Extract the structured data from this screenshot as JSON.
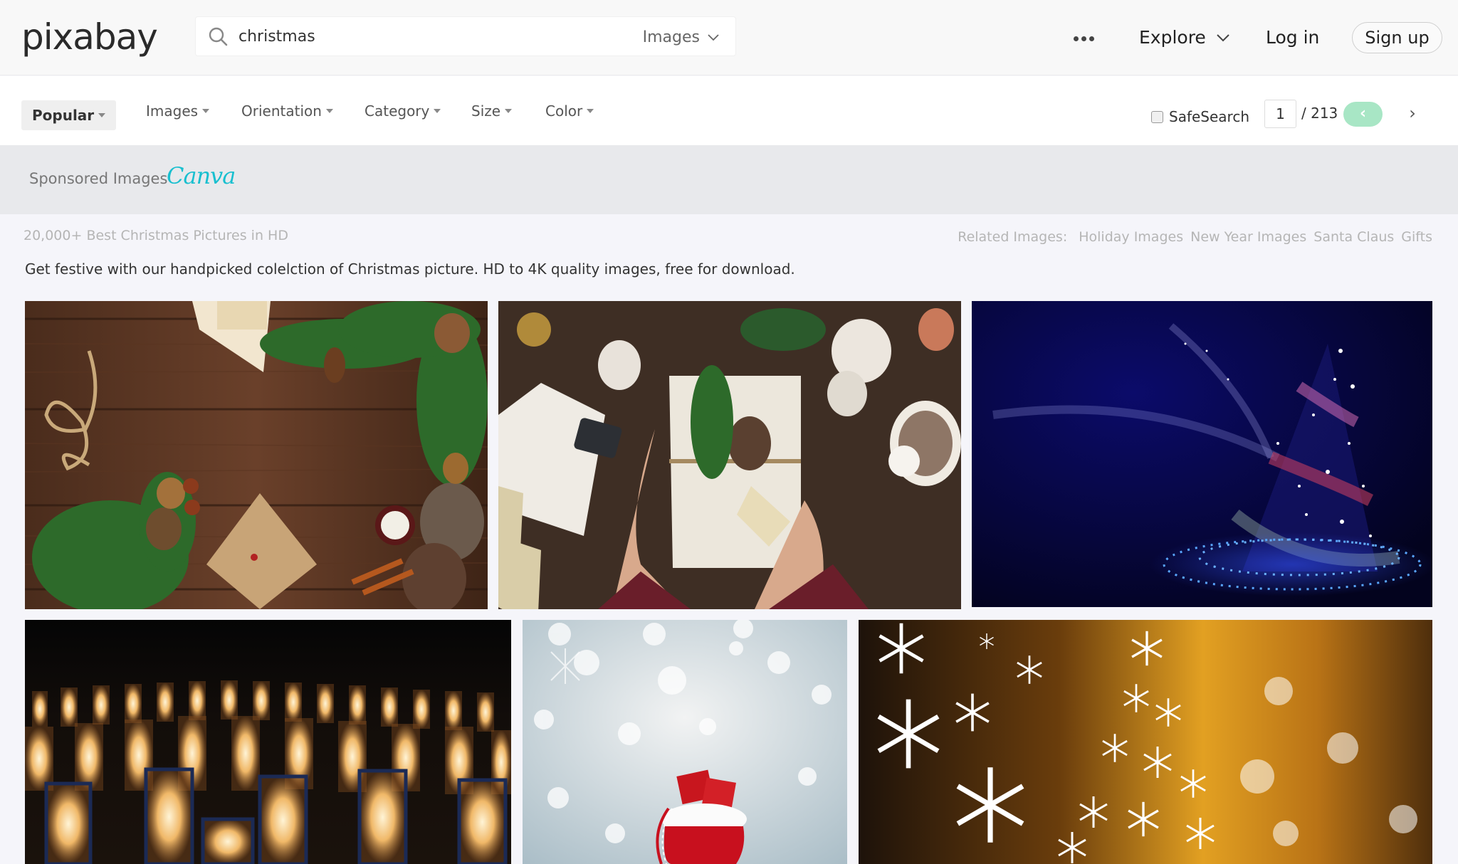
{
  "header": {
    "logo": "pixabay",
    "search": {
      "query": "christmas",
      "type_selector": "Images"
    },
    "nav": {
      "more_icon": "ellipsis-icon",
      "explore": "Explore",
      "login": "Log in",
      "signup": "Sign up"
    }
  },
  "filters": {
    "items": [
      {
        "label": "Popular",
        "active": true
      },
      {
        "label": "Images",
        "active": false
      },
      {
        "label": "Orientation",
        "active": false
      },
      {
        "label": "Category",
        "active": false
      },
      {
        "label": "Size",
        "active": false
      },
      {
        "label": "Color",
        "active": false
      }
    ],
    "safesearch": {
      "label": "SafeSearch",
      "checked": false
    },
    "pagination": {
      "current_page": "1",
      "total": "/ 213",
      "prev_icon": "‹",
      "next_icon": "›"
    }
  },
  "sponsored": {
    "label": "Sponsored Images",
    "brand": "Canva",
    "brand_color": "#18bfcf"
  },
  "results": {
    "heading": "20,000+ Best Christmas Pictures in HD",
    "related_label": "Related Images:",
    "related": [
      "Holiday Images",
      "New Year Images",
      "Santa Claus",
      "Gifts"
    ],
    "intro": "Get festive with our handpicked colelction of Christmas picture. HD to 4K quality images, free for download."
  },
  "images": [
    {
      "alt": "Christmas decorations on wooden table with pine branches, pine cones, gift and candle"
    },
    {
      "alt": "Hands holding a wrapped gift with pine cone and tag, cocoa mug with snowman marshmallow"
    },
    {
      "alt": "Sparkling abstract Christmas tree on dark blue background"
    },
    {
      "alt": "Rows of glowing paper lanterns at night"
    },
    {
      "alt": "Red Santa sack with gifts on snowy bokeh background"
    },
    {
      "alt": "Golden bokeh background with white snowflake Christmas tree"
    }
  ],
  "colors": {
    "accent_green": "#a8e6c5",
    "background": "#f5f5fa"
  }
}
